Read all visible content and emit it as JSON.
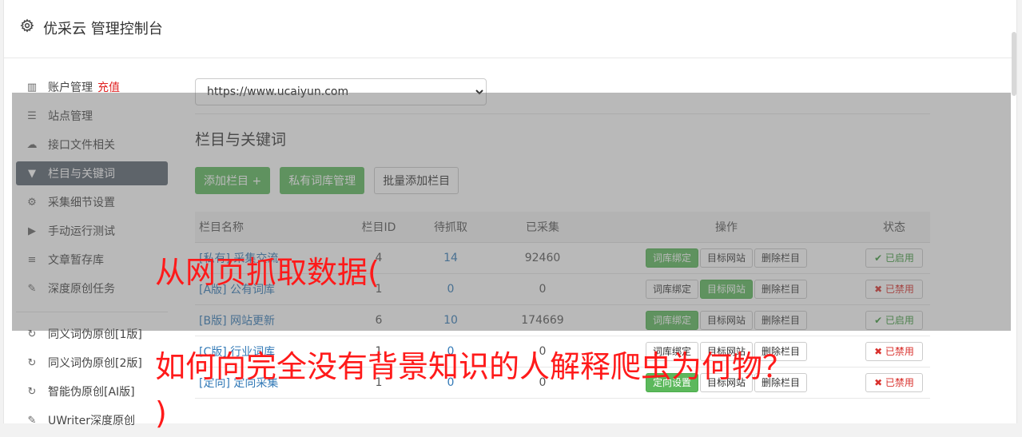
{
  "header": {
    "title": "优采云 管理控制台",
    "icon": "gear-icon"
  },
  "sidebar": {
    "items": [
      {
        "icon": "bar-chart-icon",
        "glyph": "▥",
        "label": "账户管理",
        "extra": "充值"
      },
      {
        "icon": "server-icon",
        "glyph": "☰",
        "label": "站点管理"
      },
      {
        "icon": "cloud-upload-icon",
        "glyph": "☁",
        "label": "接口文件相关"
      },
      {
        "icon": "filter-icon",
        "glyph": "▼",
        "label": "栏目与关键词",
        "active": true
      },
      {
        "icon": "cogs-icon",
        "glyph": "⚙",
        "label": "采集细节设置"
      },
      {
        "icon": "play-circle-icon",
        "glyph": "▶",
        "label": "手动运行测试"
      },
      {
        "icon": "database-icon",
        "glyph": "≡",
        "label": "文章暂存库"
      },
      {
        "icon": "edit-icon",
        "glyph": "✎",
        "label": "深度原创任务"
      }
    ],
    "items2": [
      {
        "icon": "refresh-icon",
        "glyph": "↻",
        "label": "同义词伪原创[1版]"
      },
      {
        "icon": "refresh-icon",
        "glyph": "↻",
        "label": "同义词伪原创[2版]"
      },
      {
        "icon": "refresh-icon",
        "glyph": "↻",
        "label": "智能伪原创[AI版]"
      },
      {
        "icon": "edit-icon",
        "glyph": "✎",
        "label": "UWriter深度原创"
      }
    ]
  },
  "main": {
    "site_select": "https://www.ucaiyun.com",
    "section_title": "栏目与关键词",
    "buttons": {
      "add": "添加栏目 +",
      "private_lib": "私有词库管理",
      "batch_add": "批量添加栏目"
    },
    "table": {
      "headers": [
        "栏目名称",
        "栏目ID",
        "待抓取",
        "已采集",
        "操作",
        "状态"
      ],
      "rows": [
        {
          "name": "[私有] 采集交流",
          "id": "4",
          "pending": "14",
          "collected": "92460",
          "ops": [
            "词库绑定",
            "目标网站",
            "删除栏目"
          ],
          "status": "✔ 已启用"
        },
        {
          "name": "[A版] 公有词库",
          "id": "1",
          "pending": "0",
          "collected": "0",
          "ops": [
            "词库绑定",
            "目标网站",
            "删除栏目"
          ],
          "status": "✖ 已禁用"
        },
        {
          "name": "[B版] 网站更新",
          "id": "6",
          "pending": "10",
          "collected": "174669",
          "ops": [
            "词库绑定",
            "目标网站",
            "删除栏目"
          ],
          "status": "✔ 已启用"
        },
        {
          "name": "[C版] 行业词库",
          "id": "1",
          "pending": "0",
          "collected": "0",
          "ops": [
            "词库绑定",
            "目标网站",
            "删除栏目"
          ],
          "status": "✖ 已禁用"
        },
        {
          "name": "[定向] 定向采集",
          "id": "1",
          "pending": "0",
          "collected": "0",
          "ops": [
            "定向设置",
            "目标网站",
            "删除栏目"
          ],
          "status": "✖ 已禁用"
        }
      ]
    }
  },
  "watermark": {
    "line1": "从网页抓取数据(",
    "line2": "如何向完全没有背景知识的人解释爬虫为何物？",
    "line3": ")"
  }
}
